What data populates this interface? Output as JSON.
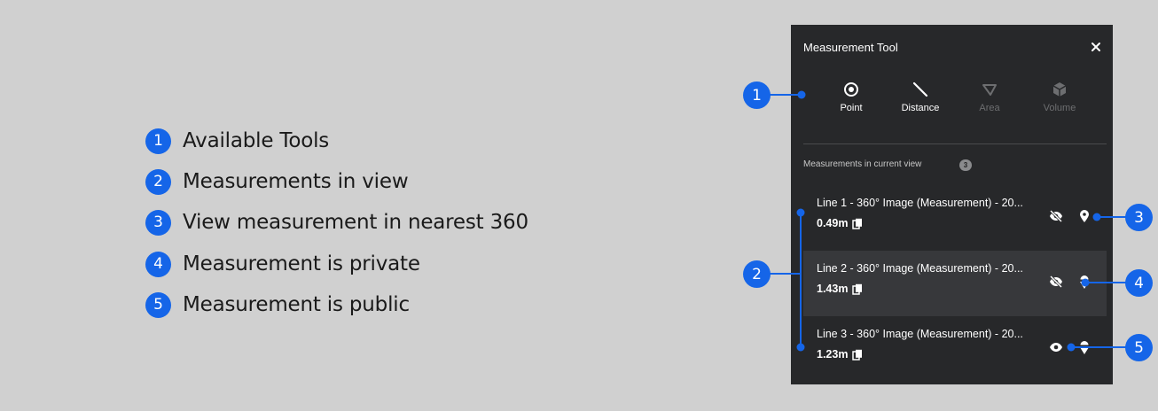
{
  "legend": [
    {
      "num": "1",
      "text": "Available Tools"
    },
    {
      "num": "2",
      "text": "Measurements in view"
    },
    {
      "num": "3",
      "text": "View measurement in nearest 360"
    },
    {
      "num": "4",
      "text": "Measurement is private"
    },
    {
      "num": "5",
      "text": "Measurement is public"
    }
  ],
  "panel": {
    "title": "Measurement Tool",
    "close_icon": "close-icon",
    "tools": [
      {
        "label": "Point",
        "icon": "target-icon",
        "enabled": true
      },
      {
        "label": "Distance",
        "icon": "line-icon",
        "enabled": true
      },
      {
        "label": "Area",
        "icon": "polygon-icon",
        "enabled": false
      },
      {
        "label": "Volume",
        "icon": "cube-icon",
        "enabled": false
      }
    ],
    "section_title": "Measurements in current view",
    "count": "3",
    "measurements": [
      {
        "name": "Line 1 - 360° Image (Measurement) - 20...",
        "value": "0.49m",
        "visibility": "private",
        "pin": "location-pin"
      },
      {
        "name": "Line 2 - 360° Image (Measurement) - 20...",
        "value": "1.43m",
        "visibility": "private",
        "pin": "location-pin-dropdown"
      },
      {
        "name": "Line 3 - 360° Image (Measurement) - 20...",
        "value": "1.23m",
        "visibility": "public",
        "pin": "location-pin-dropdown"
      }
    ]
  },
  "callouts": [
    "1",
    "2",
    "3",
    "4",
    "5"
  ],
  "colors": {
    "background": "#d0d0d0",
    "panel": "#27282a",
    "highlight_row": "#37383b",
    "accent": "#1565e8",
    "disabled_text": "#6d6e70"
  }
}
